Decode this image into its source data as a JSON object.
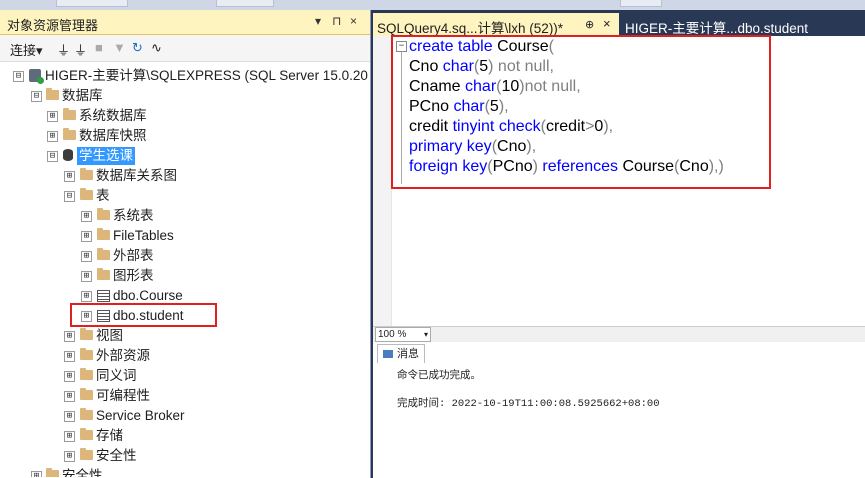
{
  "object_explorer": {
    "title": "对象资源管理器",
    "title_icons": [
      "▾",
      "⊓",
      "×"
    ],
    "toolbar": {
      "connect_label": "连接▾"
    },
    "tree": [
      {
        "label": "HIGER-主要计算\\SQLEXPRESS (SQL Server 15.0.200",
        "expander": "⊟",
        "icon": "server-icon"
      },
      {
        "label": "数据库",
        "expander": "⊟",
        "icon": "folder-icon"
      },
      {
        "label": "系统数据库",
        "expander": "⊞",
        "icon": "folder-icon"
      },
      {
        "label": "数据库快照",
        "expander": "⊞",
        "icon": "folder-icon"
      },
      {
        "label": "学生选课",
        "expander": "⊟",
        "icon": "database-icon",
        "selected": true
      },
      {
        "label": "数据库关系图",
        "expander": "⊞",
        "icon": "folder-icon"
      },
      {
        "label": "表",
        "expander": "⊟",
        "icon": "folder-icon"
      },
      {
        "label": "系统表",
        "expander": "⊞",
        "icon": "folder-icon"
      },
      {
        "label": "FileTables",
        "expander": "⊞",
        "icon": "folder-icon"
      },
      {
        "label": "外部表",
        "expander": "⊞",
        "icon": "folder-icon"
      },
      {
        "label": "图形表",
        "expander": "⊞",
        "icon": "folder-icon"
      },
      {
        "label": "dbo.Course",
        "expander": "⊞",
        "icon": "table-icon"
      },
      {
        "label": "dbo.student",
        "expander": "⊞",
        "icon": "table-icon"
      },
      {
        "label": "视图",
        "expander": "⊞",
        "icon": "folder-icon"
      },
      {
        "label": "外部资源",
        "expander": "⊞",
        "icon": "folder-icon"
      },
      {
        "label": "同义词",
        "expander": "⊞",
        "icon": "folder-icon"
      },
      {
        "label": "可编程性",
        "expander": "⊞",
        "icon": "folder-icon"
      },
      {
        "label": "Service Broker",
        "expander": "⊞",
        "icon": "folder-icon"
      },
      {
        "label": "存储",
        "expander": "⊞",
        "icon": "folder-icon"
      },
      {
        "label": "安全性",
        "expander": "⊞",
        "icon": "folder-icon"
      },
      {
        "label": "安全性",
        "expander": "⊞",
        "icon": "folder-icon"
      }
    ]
  },
  "tabs": {
    "active": {
      "label": "SQLQuery4.sq...计算\\lxh (52))*",
      "pin": "⊕",
      "close": "×"
    },
    "other": {
      "label": "HIGER-主要计算...dbo.student"
    }
  },
  "editor": {
    "collapse_glyph": "−",
    "lines": [
      [
        {
          "t": "create table ",
          "c": "kw"
        },
        {
          "t": "Course",
          "c": "id"
        },
        {
          "t": "(",
          "c": "gr"
        }
      ],
      [
        {
          "t": "Cno ",
          "c": "id"
        },
        {
          "t": "char",
          "c": "kw"
        },
        {
          "t": "(",
          "c": "gr"
        },
        {
          "t": "5",
          "c": "id"
        },
        {
          "t": ") not null,",
          "c": "gr"
        }
      ],
      [
        {
          "t": "Cname ",
          "c": "id"
        },
        {
          "t": "char",
          "c": "kw"
        },
        {
          "t": "(",
          "c": "gr"
        },
        {
          "t": "10",
          "c": "id"
        },
        {
          "t": ")not null,",
          "c": "gr"
        }
      ],
      [
        {
          "t": "PCno ",
          "c": "id"
        },
        {
          "t": "char",
          "c": "kw"
        },
        {
          "t": "(",
          "c": "gr"
        },
        {
          "t": "5",
          "c": "id"
        },
        {
          "t": "),",
          "c": "gr"
        }
      ],
      [
        {
          "t": "credit ",
          "c": "id"
        },
        {
          "t": "tinyint ",
          "c": "kw"
        },
        {
          "t": "check",
          "c": "kw"
        },
        {
          "t": "(",
          "c": "gr"
        },
        {
          "t": "credit",
          "c": "id"
        },
        {
          "t": ">",
          "c": "gr"
        },
        {
          "t": "0",
          "c": "id"
        },
        {
          "t": "),",
          "c": "gr"
        }
      ],
      [
        {
          "t": "primary key",
          "c": "kw"
        },
        {
          "t": "(",
          "c": "gr"
        },
        {
          "t": "Cno",
          "c": "id"
        },
        {
          "t": "),",
          "c": "gr"
        }
      ],
      [
        {
          "t": "foreign key",
          "c": "kw"
        },
        {
          "t": "(",
          "c": "gr"
        },
        {
          "t": "PCno",
          "c": "id"
        },
        {
          "t": ") ",
          "c": "gr"
        },
        {
          "t": "references ",
          "c": "kw"
        },
        {
          "t": "Course",
          "c": "id"
        },
        {
          "t": "(",
          "c": "gr"
        },
        {
          "t": "Cno",
          "c": "id"
        },
        {
          "t": "),)",
          "c": "gr"
        }
      ]
    ]
  },
  "zoom": {
    "value": "100 %",
    "dropdown": "▾"
  },
  "results": {
    "tab_label": "消息",
    "message": "命令已成功完成。",
    "completion": "完成时间: 2022-10-19T11:00:08.5925662+08:00"
  },
  "colors": {
    "keyword": "#0000ff",
    "punct": "#808080",
    "selection": "#3399ff",
    "highlight_box": "#e02020",
    "tab_active": "#fdf4bf"
  }
}
